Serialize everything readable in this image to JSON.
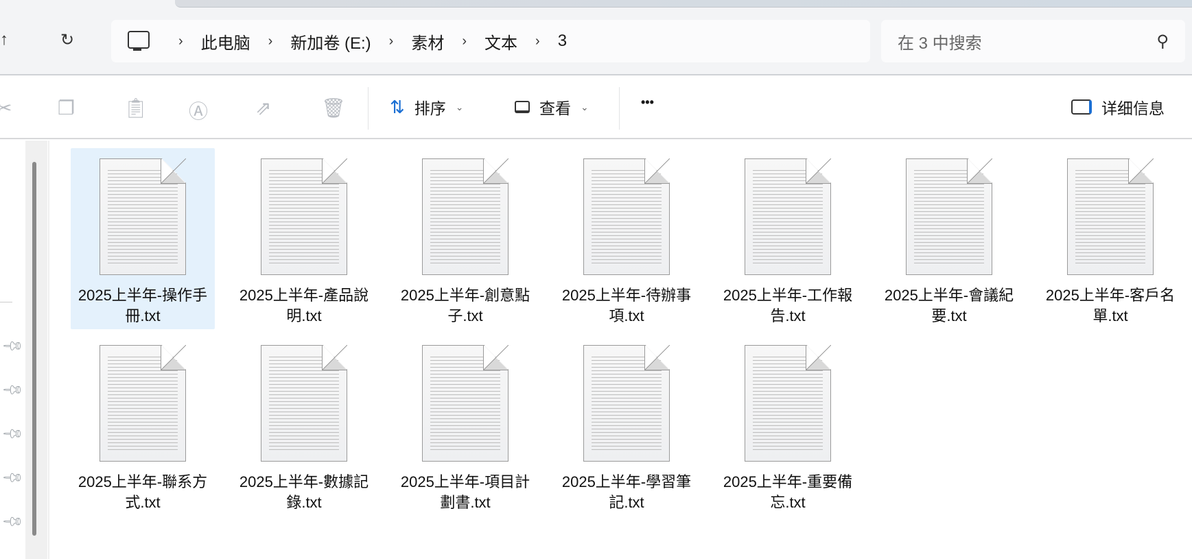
{
  "nav": {
    "up": "↑",
    "refresh": "↻"
  },
  "breadcrumb": [
    "此电脑",
    "新加卷 (E:)",
    "素材",
    "文本",
    "3"
  ],
  "search": {
    "placeholder": "在 3 中搜索"
  },
  "toolbar": {
    "sort": "排序",
    "view": "查看",
    "more": "•••",
    "details": "详细信息"
  },
  "files": [
    {
      "name": "2025上半年-操作手冊.txt",
      "selected": true
    },
    {
      "name": "2025上半年-產品說明.txt"
    },
    {
      "name": "2025上半年-創意點子.txt"
    },
    {
      "name": "2025上半年-待辦事項.txt"
    },
    {
      "name": "2025上半年-工作報告.txt"
    },
    {
      "name": "2025上半年-會議紀要.txt"
    },
    {
      "name": "2025上半年-客戶名單.txt"
    },
    {
      "name": "2025上半年-聯系方式.txt"
    },
    {
      "name": "2025上半年-數據記錄.txt"
    },
    {
      "name": "2025上半年-項目計劃書.txt"
    },
    {
      "name": "2025上半年-學習筆記.txt"
    },
    {
      "name": "2025上半年-重要備忘.txt"
    }
  ]
}
